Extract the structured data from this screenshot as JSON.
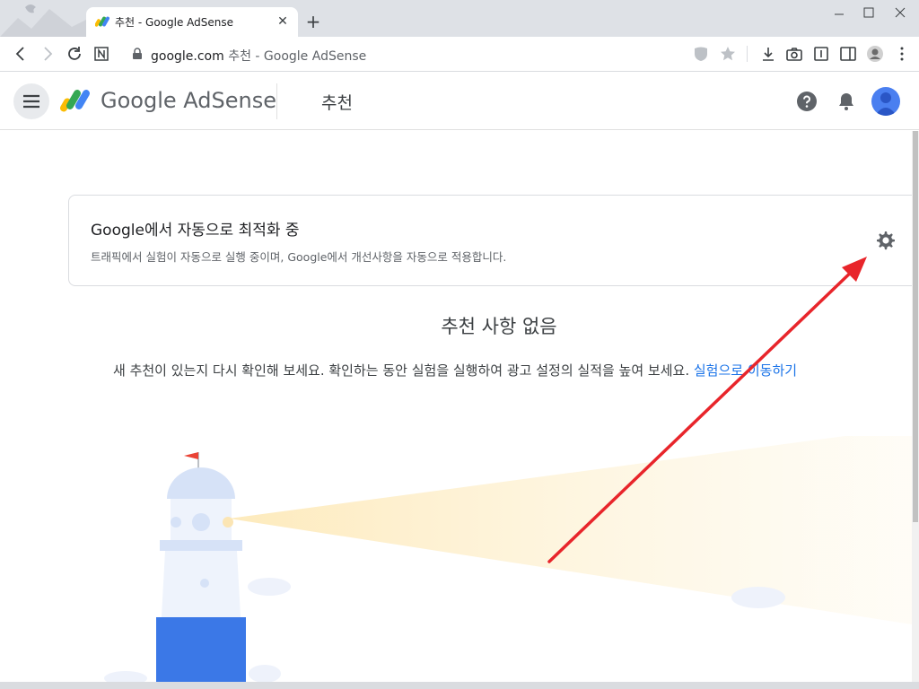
{
  "browser": {
    "tab_title": "추천 - Google AdSense",
    "url_host": "google.com",
    "url_rest": " 추천 - Google AdSense"
  },
  "header": {
    "brand": "Google AdSense",
    "page_title": "추천"
  },
  "card": {
    "title": "Google에서 자동으로 최적화 중",
    "description": "트래픽에서 실험이 자동으로 실행 중이며, Google에서 개선사항을 자동으로 적용합니다."
  },
  "empty_state": {
    "title": "추천 사항 없음",
    "description": "새 추천이 있는지 다시 확인해 보세요. 확인하는 동안 실험을 실행하여 광고 설정의 실적을 높여 보세요.",
    "link": "실험으로 이동하기"
  },
  "colors": {
    "link": "#1a73e8",
    "annotation_arrow": "#e8252b",
    "lighthouse_band": "#3b78e7"
  },
  "icons": {
    "back": "arrow-left-icon",
    "forward": "arrow-right-icon",
    "reload": "reload-icon",
    "gear": "gear-icon",
    "help": "help-icon",
    "bell": "bell-icon"
  }
}
